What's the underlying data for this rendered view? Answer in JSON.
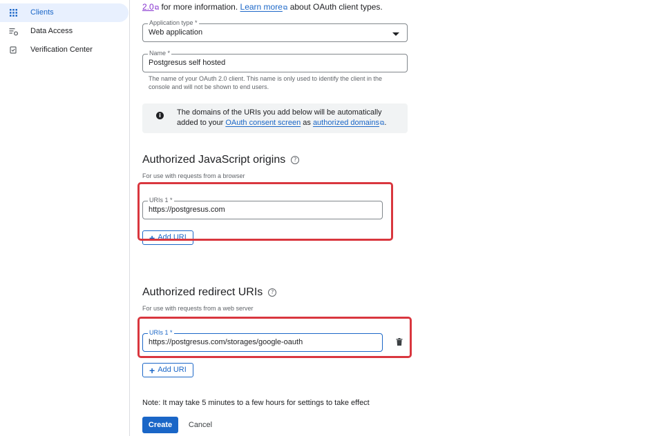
{
  "sidebar": {
    "items": [
      {
        "label": "Clients",
        "icon": "grid-icon",
        "active": true
      },
      {
        "label": "Data Access",
        "icon": "data-access-icon",
        "active": false
      },
      {
        "label": "Verification Center",
        "icon": "verified-icon",
        "active": false
      }
    ]
  },
  "intro": {
    "version_link": "2.0",
    "text_1": "for more information.",
    "learn_more": "Learn more",
    "text_2": "about OAuth client types."
  },
  "form": {
    "app_type": {
      "label": "Application type *",
      "value": "Web application"
    },
    "name": {
      "label": "Name *",
      "value": "Postgresus self hosted",
      "helper": "The name of your OAuth 2.0 client. This name is only used to identify the client in the console and will not be shown to end users."
    },
    "info": {
      "text_1": "The domains of the URIs you add below will be automatically added to your",
      "link_1": "OAuth consent screen",
      "text_2": "as",
      "link_2": "authorized domains",
      "text_3": "."
    }
  },
  "js_origins": {
    "title": "Authorized JavaScript origins",
    "subtitle": "For use with requests from a browser",
    "uri_label": "URIs 1 *",
    "uri_value": "https://postgresus.com",
    "add_label": "Add URI"
  },
  "redirect_uris": {
    "title": "Authorized redirect URIs",
    "subtitle": "For use with requests from a web server",
    "uri_label": "URIs 1 *",
    "uri_value": "https://postgresus.com/storages/google-oauth",
    "add_label": "Add URI"
  },
  "footer": {
    "note": "Note: It may take 5 minutes to a few hours for settings to take effect",
    "create": "Create",
    "cancel": "Cancel"
  },
  "colors": {
    "accent": "#1a66c7",
    "highlight": "#d9363e",
    "sidebar_active_bg": "#e8f0fe"
  }
}
